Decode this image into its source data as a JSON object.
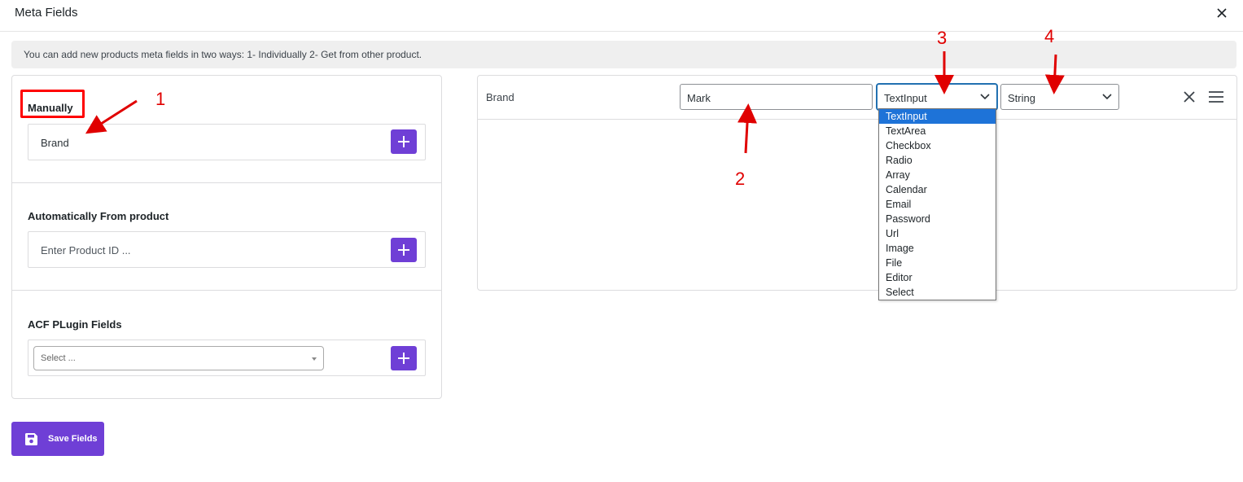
{
  "header": {
    "title": "Meta Fields"
  },
  "info": {
    "text": "You can add new products meta fields in two ways: 1- Individually 2- Get from other product."
  },
  "left": {
    "manually": {
      "label": "Manually",
      "value": "Brand"
    },
    "automatic": {
      "label": "Automatically From product",
      "placeholder": "Enter Product ID ..."
    },
    "acf": {
      "label": "ACF PLugin Fields",
      "select_placeholder": "Select ..."
    }
  },
  "save": {
    "label": "Save Fields"
  },
  "row": {
    "name": "Brand",
    "label_value": "Mark",
    "type_value": "TextInput",
    "value_type": "String"
  },
  "dropdown": {
    "options": [
      "TextInput",
      "TextArea",
      "Checkbox",
      "Radio",
      "Array",
      "Calendar",
      "Email",
      "Password",
      "Url",
      "Image",
      "File",
      "Editor",
      "Select"
    ],
    "selected_index": 0
  },
  "annotations": [
    "1",
    "2",
    "3",
    "4"
  ],
  "colors": {
    "accent": "#6f3fd6",
    "annotation": "#e00000",
    "selection": "#1e73d8"
  }
}
